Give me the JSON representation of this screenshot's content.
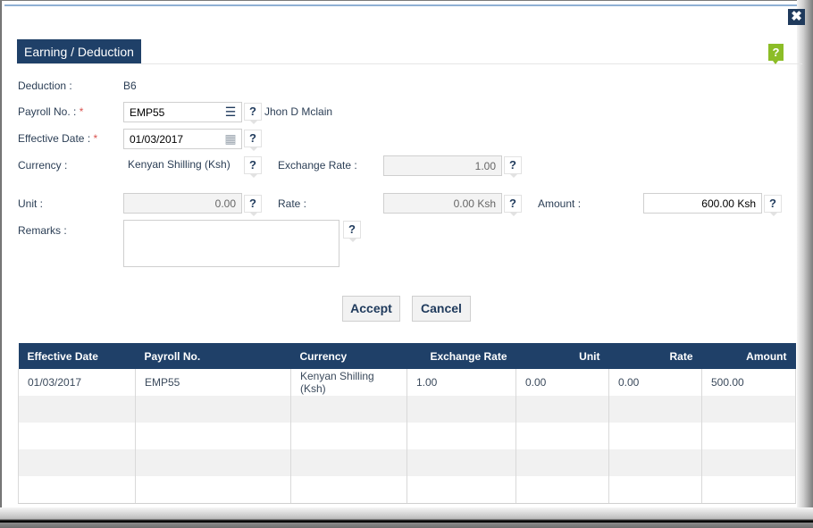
{
  "dialog": {
    "title": "Earning / Deduction",
    "close_icon": "close-icon",
    "help_icon": "help-icon"
  },
  "form": {
    "deduction_label": "Deduction :",
    "deduction_value": "B6",
    "payroll_label": "Payroll No. :",
    "payroll_value": "EMP55",
    "payroll_name": "Jhon D Mclain",
    "effective_date_label": "Effective Date :",
    "effective_date_value": "01/03/2017",
    "currency_label": "Currency :",
    "currency_value": "Kenyan Shilling (Ksh)",
    "exchange_rate_label": "Exchange Rate :",
    "exchange_rate_value": "1.00",
    "unit_label": "Unit :",
    "unit_value": "0.00",
    "rate_label": "Rate :",
    "rate_value": "0.00 Ksh",
    "amount_label": "Amount :",
    "amount_value": "600.00 Ksh",
    "remarks_label": "Remarks :",
    "remarks_value": "",
    "required_mark": "*",
    "help_mark": "?"
  },
  "buttons": {
    "accept": "Accept",
    "cancel": "Cancel"
  },
  "grid": {
    "columns": [
      "Effective Date",
      "Payroll No.",
      "Currency",
      "Exchange Rate",
      "Unit",
      "Rate",
      "Amount"
    ],
    "rows": [
      [
        "01/03/2017",
        "EMP55",
        "Kenyan Shilling (Ksh)",
        "1.00",
        "0.00",
        "0.00",
        "500.00"
      ]
    ]
  }
}
